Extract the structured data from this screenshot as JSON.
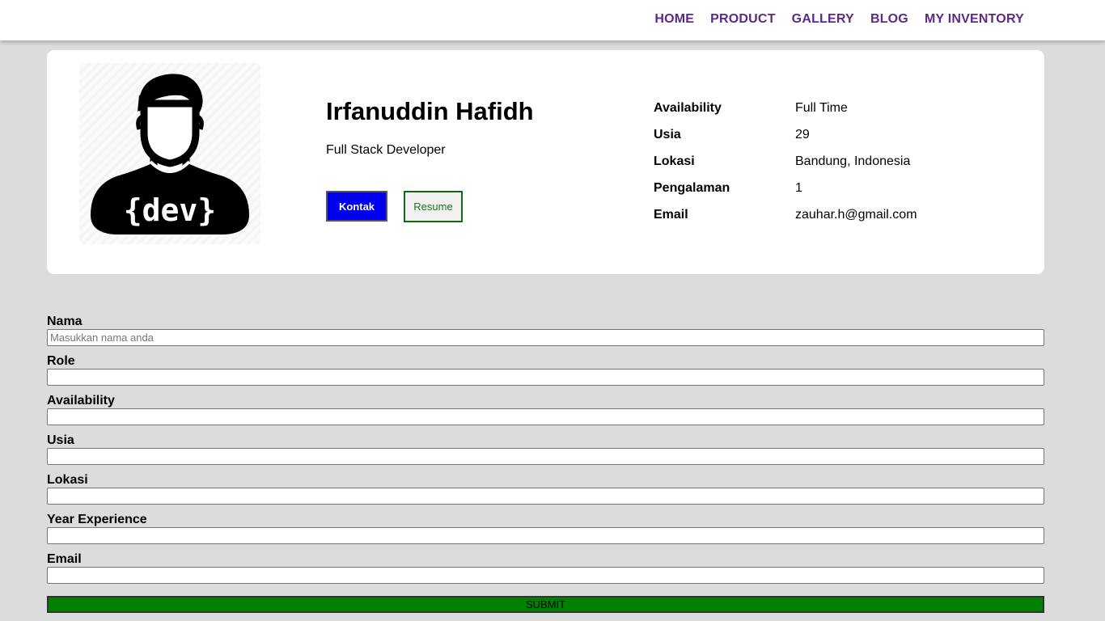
{
  "nav": {
    "items": [
      {
        "label": "HOME"
      },
      {
        "label": "PRODUCT"
      },
      {
        "label": "GALLERY"
      },
      {
        "label": "BLOG"
      },
      {
        "label": "MY INVENTORY"
      }
    ],
    "link_color": "#5b2a86"
  },
  "profile": {
    "avatar_icon": "developer-avatar-icon",
    "avatar_text": "{dev}",
    "name": "Irfanuddin Hafidh",
    "role": "Full Stack Developer",
    "buttons": {
      "kontak": "Kontak",
      "resume": "Resume"
    },
    "info": [
      {
        "key": "Availability",
        "value": "Full Time"
      },
      {
        "key": "Usia",
        "value": "29"
      },
      {
        "key": "Lokasi",
        "value": "Bandung, Indonesia"
      },
      {
        "key": "Pengalaman",
        "value": "1"
      },
      {
        "key": "Email",
        "value": "zauhar.h@gmail.com"
      }
    ]
  },
  "form": {
    "fields": [
      {
        "label": "Nama",
        "placeholder": "Masukkan nama anda",
        "value": ""
      },
      {
        "label": "Role",
        "placeholder": "",
        "value": ""
      },
      {
        "label": "Availability",
        "placeholder": "",
        "value": ""
      },
      {
        "label": "Usia",
        "placeholder": "",
        "value": ""
      },
      {
        "label": "Lokasi",
        "placeholder": "",
        "value": ""
      },
      {
        "label": "Year Experience",
        "placeholder": "",
        "value": ""
      },
      {
        "label": "Email",
        "placeholder": "",
        "value": ""
      }
    ],
    "submit_label": "SUBMIT"
  },
  "colors": {
    "background": "#dcdcdc",
    "kontak_button": "#0000ee",
    "resume_border": "#126912",
    "submit_button": "#008000"
  }
}
